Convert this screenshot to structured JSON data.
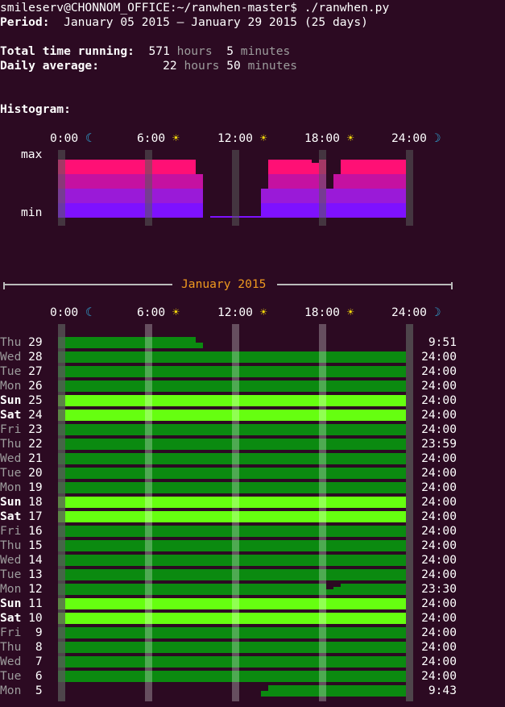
{
  "terminal": {
    "prompt": "smileserv@CHONNOM_OFFICE:~/ranwhen-master$ ./ranwhen.py",
    "period_label": "Period:",
    "period_value": "January 05 2015 – January 29 2015",
    "period_days": "(25 days)",
    "total_label": "Total time running:",
    "total_hours": "571",
    "total_minutes": "5",
    "avg_label": "Daily average:",
    "avg_hours": "22",
    "avg_minutes": "50",
    "hours_word": "hours",
    "minutes_word": "minutes",
    "histogram_label": "Histogram:",
    "hist_max": "max",
    "hist_min": "min",
    "month_title": "January 2015"
  },
  "time_axis": [
    {
      "label": "0:00",
      "icon": "☾",
      "icon_name": "moon-icon"
    },
    {
      "label": "6:00",
      "icon": "☀",
      "icon_name": "sun-icon"
    },
    {
      "label": "12:00",
      "icon": "☀",
      "icon_name": "sun-icon"
    },
    {
      "label": "18:00",
      "icon": "☀",
      "icon_name": "sun-icon"
    },
    {
      "label": "24:00",
      "icon": "☽",
      "icon_name": "moon-icon"
    }
  ],
  "colors": {
    "background": "#2c0a22",
    "weekday_bar": "#0b8a10",
    "weekend_bar": "#66ff10",
    "hour_marker": "#5a5a5a",
    "hist_pink": "#ff1075",
    "hist_magenta": "#c511a1",
    "hist_purple": "#9a1ad8",
    "hist_violet": "#7e11ff"
  },
  "days": [
    {
      "dow": "Thu",
      "day": "29",
      "total": "9:51",
      "weekend": false
    },
    {
      "dow": "Wed",
      "day": "28",
      "total": "24:00",
      "weekend": false
    },
    {
      "dow": "Tue",
      "day": "27",
      "total": "24:00",
      "weekend": false
    },
    {
      "dow": "Mon",
      "day": "26",
      "total": "24:00",
      "weekend": false
    },
    {
      "dow": "Sun",
      "day": "25",
      "total": "24:00",
      "weekend": true
    },
    {
      "dow": "Sat",
      "day": "24",
      "total": "24:00",
      "weekend": true
    },
    {
      "dow": "Fri",
      "day": "23",
      "total": "24:00",
      "weekend": false
    },
    {
      "dow": "Thu",
      "day": "22",
      "total": "23:59",
      "weekend": false
    },
    {
      "dow": "Wed",
      "day": "21",
      "total": "24:00",
      "weekend": false
    },
    {
      "dow": "Tue",
      "day": "20",
      "total": "24:00",
      "weekend": false
    },
    {
      "dow": "Mon",
      "day": "19",
      "total": "24:00",
      "weekend": false
    },
    {
      "dow": "Sun",
      "day": "18",
      "total": "24:00",
      "weekend": true
    },
    {
      "dow": "Sat",
      "day": "17",
      "total": "24:00",
      "weekend": true
    },
    {
      "dow": "Fri",
      "day": "16",
      "total": "24:00",
      "weekend": false
    },
    {
      "dow": "Thu",
      "day": "15",
      "total": "24:00",
      "weekend": false
    },
    {
      "dow": "Wed",
      "day": "14",
      "total": "24:00",
      "weekend": false
    },
    {
      "dow": "Tue",
      "day": "13",
      "total": "24:00",
      "weekend": false
    },
    {
      "dow": "Mon",
      "day": "12",
      "total": "23:30",
      "weekend": false
    },
    {
      "dow": "Sun",
      "day": "11",
      "total": "24:00",
      "weekend": true
    },
    {
      "dow": "Sat",
      "day": "10",
      "total": "24:00",
      "weekend": true
    },
    {
      "dow": "Fri",
      "day": "9",
      "total": "24:00",
      "weekend": false
    },
    {
      "dow": "Thu",
      "day": "8",
      "total": "24:00",
      "weekend": false
    },
    {
      "dow": "Wed",
      "day": "7",
      "total": "24:00",
      "weekend": false
    },
    {
      "dow": "Tue",
      "day": "6",
      "total": "24:00",
      "weekend": false
    },
    {
      "dow": "Mon",
      "day": "5",
      "total": "9:43",
      "weekend": false
    }
  ]
}
